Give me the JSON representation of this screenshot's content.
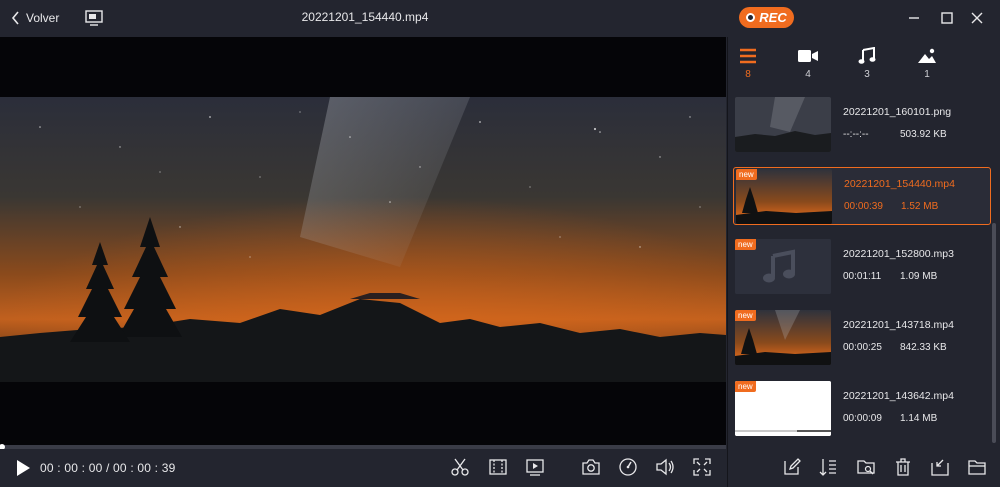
{
  "titlebar": {
    "back_label": "Volver",
    "file_title": "20221201_154440.mp4",
    "rec_label": "REC",
    "icons": [
      "chevron-left-icon",
      "screen-icon",
      "minimize-icon",
      "maximize-icon",
      "close-icon"
    ]
  },
  "player": {
    "time": "00 : 00 : 00 / 00 : 00 : 39",
    "progress": 0,
    "controls": [
      "scissors-icon",
      "trim-icon",
      "split-screen-icon",
      "screenshot-icon",
      "speed-icon",
      "volume-icon",
      "fullscreen-icon"
    ]
  },
  "categories": [
    {
      "icon": "list-icon",
      "count": "8",
      "active": true
    },
    {
      "icon": "video-icon",
      "count": "4"
    },
    {
      "icon": "music-icon",
      "count": "3"
    },
    {
      "icon": "image-icon",
      "count": "1"
    }
  ],
  "files": [
    {
      "name": "20221201_160101.png",
      "duration": "--:--:--",
      "size": "503.92 KB",
      "new": false,
      "type": "image"
    },
    {
      "name": "20221201_154440.mp4",
      "duration": "00:00:39",
      "size": "1.52 MB",
      "new": true,
      "type": "video",
      "selected": true
    },
    {
      "name": "20221201_152800.mp3",
      "duration": "00:01:11",
      "size": "1.09 MB",
      "new": true,
      "type": "audio"
    },
    {
      "name": "20221201_143718.mp4",
      "duration": "00:00:25",
      "size": "842.33 KB",
      "new": true,
      "type": "video"
    },
    {
      "name": "20221201_143642.mp4",
      "duration": "00:00:09",
      "size": "1.14 MB",
      "new": true,
      "type": "video-white"
    }
  ],
  "badge_label": "new",
  "toolbar": [
    "edit-icon",
    "sort-icon",
    "folder-search-icon",
    "trash-icon",
    "export-icon",
    "folder-icon"
  ],
  "colors": {
    "accent": "#f06c1f",
    "background": "#23252f"
  }
}
